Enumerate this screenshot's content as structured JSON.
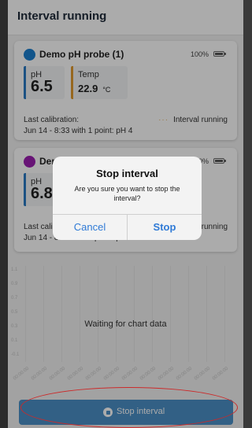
{
  "header": {
    "title": "Interval running"
  },
  "probes": [
    {
      "name": "Demo pH probe (1)",
      "dot_color": "#1b7fcf",
      "battery": "100%",
      "ph": {
        "label": "pH",
        "value": "6.5",
        "accent": "#2a7bc4"
      },
      "temp": {
        "label": "Temp",
        "value": "22.9",
        "unit": "°C",
        "accent": "#e29a2e"
      },
      "calibration_label": "Last calibration:",
      "calibration_detail": "Jun 14 - 8:33 with 1 point: pH 4",
      "interval_status": "Interval running"
    },
    {
      "name": "Der",
      "dot_color": "#9b1fb0",
      "battery": "100%",
      "ph": {
        "label": "pH",
        "value": "6.8",
        "accent": "#2a7bc4"
      },
      "calibration_label": "Last cali",
      "calibration_detail": "Jun 14 - 8:40 with 1 point: pH 4",
      "interval_status": "running"
    }
  ],
  "chart": {
    "y_ticks": [
      "1.1",
      "0.9",
      "0.7",
      "0.5",
      "0.3",
      "0.1",
      "-0.1"
    ],
    "x_ticks": [
      "00:00:00",
      "00:00:00",
      "00:00:00",
      "00:00:00",
      "00:00:00",
      "00:00:00",
      "00:00:00",
      "00:00:00",
      "00:00:00",
      "00:00:00",
      "00:00:00",
      "00:00:00"
    ],
    "empty_message": "Waiting for chart data"
  },
  "footer": {
    "stop_button_label": "Stop interval"
  },
  "dialog": {
    "title": "Stop interval",
    "message": "Are you sure you want to stop the interval?",
    "cancel_label": "Cancel",
    "confirm_label": "Stop"
  },
  "annotation": {
    "color": "#cc2a2a"
  }
}
